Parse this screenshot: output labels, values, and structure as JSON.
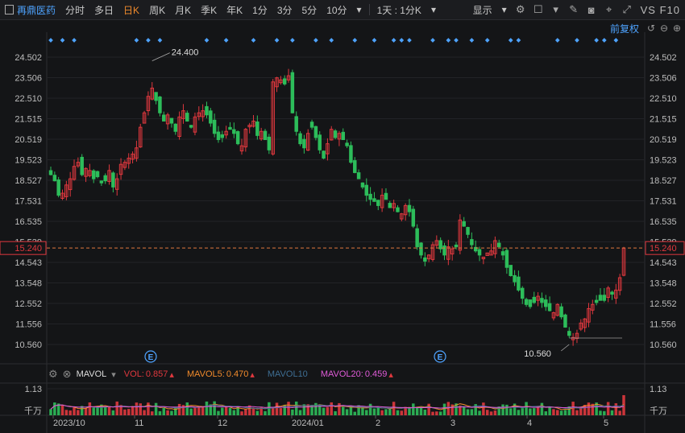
{
  "toolbar": {
    "stock_name": "再鼎医药",
    "periods": [
      "分时",
      "多日",
      "日K",
      "周K",
      "月K",
      "季K",
      "年K",
      "1分",
      "3分",
      "5分",
      "10分"
    ],
    "active_period": "日K",
    "interval_select": "1天 : 1分K",
    "display_label": "显示",
    "vs_f10": "VS F10",
    "fuquan": "前复权"
  },
  "price_axis": {
    "labels": [
      "24.502",
      "23.506",
      "22.510",
      "21.515",
      "20.519",
      "19.523",
      "18.527",
      "17.531",
      "16.535",
      "15.539",
      "14.543",
      "13.548",
      "12.552",
      "11.556",
      "10.560"
    ],
    "current_price": "15.240",
    "current_value": 15.24,
    "max_label": "24.400",
    "min_label": "10.560"
  },
  "x_axis": {
    "labels": [
      "2023/10",
      "11",
      "12",
      "2024/01",
      "2",
      "3",
      "4",
      "5"
    ]
  },
  "event_marker": "E",
  "volume": {
    "indicator": "MAVOL",
    "vol_label": "VOL:",
    "vol_value": "0.857",
    "mavol5_label": "MAVOL5:",
    "mavol5_value": "0.470",
    "mavol10_label": "MAVOL10",
    "mavol20_label": "MAVOL20:",
    "mavol20_value": "0.459",
    "axis_top": "1.13",
    "axis_unit": "千万"
  },
  "colors": {
    "up": "#e0383e",
    "down": "#2dbd5a",
    "accent": "#f28b2c",
    "link": "#4ea3ff",
    "mavol10": "#3e6e93",
    "mavol20": "#e05bd8"
  },
  "chart_data": {
    "type": "candlestick",
    "ylim": [
      10.56,
      24.502
    ],
    "y_ticks": [
      24.502,
      23.506,
      22.51,
      21.515,
      20.519,
      19.523,
      18.527,
      17.531,
      16.535,
      15.539,
      14.543,
      13.548,
      12.552,
      11.556,
      10.56
    ],
    "x_tick_labels": [
      "2023/10",
      "11",
      "12",
      "2024/01",
      "2",
      "3",
      "4",
      "5"
    ],
    "highest": 24.4,
    "lowest": 10.56,
    "last_close": 15.24,
    "closes": [
      18.8,
      18.5,
      17.8,
      17.9,
      18.3,
      18.6,
      19.2,
      19.4,
      18.8,
      19.1,
      19.0,
      18.6,
      18.7,
      18.4,
      18.5,
      19.0,
      18.2,
      18.6,
      19.3,
      19.4,
      19.6,
      19.8,
      20.1,
      21.1,
      21.8,
      22.6,
      23.0,
      22.4,
      21.8,
      21.4,
      21.7,
      21.3,
      20.9,
      21.6,
      21.9,
      21.4,
      21.1,
      21.6,
      21.8,
      21.9,
      21.7,
      21.3,
      20.8,
      20.5,
      20.6,
      20.9,
      21.0,
      20.8,
      20.3,
      20.2,
      21.0,
      21.2,
      21.4,
      20.7,
      20.9,
      20.5,
      20.0,
      23.3,
      23.5,
      23.4,
      23.2,
      23.6,
      21.8,
      20.9,
      20.3,
      20.1,
      20.8,
      21.1,
      20.6,
      20.0,
      19.6,
      20.3,
      21.0,
      20.6,
      20.8,
      20.5,
      20.2,
      19.4,
      18.9,
      18.6,
      18.2,
      17.8,
      17.6,
      17.5,
      17.3,
      17.8,
      17.6,
      17.2,
      17.4,
      17.0,
      16.9,
      17.3,
      17.0,
      16.3,
      15.3,
      14.9,
      14.6,
      14.9,
      15.4,
      15.6,
      15.2,
      14.9,
      15.3,
      15.2,
      15.3,
      16.6,
      16.3,
      15.9,
      15.4,
      15.1,
      14.9,
      14.8,
      15.0,
      15.1,
      15.6,
      15.3,
      14.9,
      14.3,
      13.9,
      13.6,
      13.2,
      12.8,
      12.5,
      12.4,
      12.6,
      12.9,
      12.6,
      12.4,
      12.2,
      12.1,
      12.5,
      11.9,
      11.4,
      11.0,
      10.9,
      11.1,
      11.6,
      11.8,
      12.3,
      12.5,
      12.6,
      12.7,
      12.7,
      13.3,
      13.0,
      13.2,
      13.8,
      15.24
    ],
    "volume_ylim": [
      0,
      1.13
    ],
    "volume_unit": "千万",
    "vol_last": 0.857,
    "mavol5_last": 0.47,
    "mavol20_last": 0.459
  }
}
